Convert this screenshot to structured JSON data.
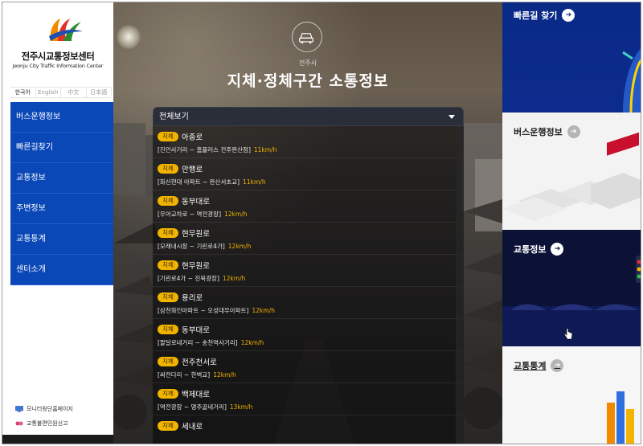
{
  "logo": {
    "title": "전주시교통정보센터",
    "subtitle": "Jeonju City Traffic Information Center"
  },
  "languages": [
    "한국어",
    "English",
    "中文",
    "日本語"
  ],
  "menu": [
    {
      "label": "버스운행정보"
    },
    {
      "label": "빠른길찾기"
    },
    {
      "label": "교통정보"
    },
    {
      "label": "주변정보"
    },
    {
      "label": "교통통계"
    },
    {
      "label": "센터소개"
    }
  ],
  "bottom_links": [
    {
      "label": "모니터링단홈페이지",
      "icon": "monitor-icon"
    },
    {
      "label": "교통불편민원신고",
      "icon": "complaint-icon"
    }
  ],
  "center": {
    "sub_title": "전주시",
    "title": "지체·정체구간 소통정보",
    "select_value": "전체보기",
    "rows": [
      {
        "badge": "지체",
        "road": "아중로",
        "section": "[진안사거리 ~ 홈플러스 전주완산점]",
        "speed": "11km/h"
      },
      {
        "badge": "지체",
        "road": "안행로",
        "section": "[화산현대 아파트 ~ 완산서초교]",
        "speed": "11km/h"
      },
      {
        "badge": "지체",
        "road": "동부대로",
        "section": "[우아교차로 ~ 역전광장]",
        "speed": "12km/h"
      },
      {
        "badge": "지체",
        "road": "현무원로",
        "section": "[모래내시장 ~ 기린로4가]",
        "speed": "12km/h"
      },
      {
        "badge": "지체",
        "road": "현무원로",
        "section": "[기린로4가 ~ 진북광장]",
        "speed": "12km/h"
      },
      {
        "badge": "지체",
        "road": "용리로",
        "section": "[삼천화인아파트 ~ 오성대우아파트]",
        "speed": "12km/h"
      },
      {
        "badge": "지체",
        "road": "동부대로",
        "section": "[팔달로네거리 ~ 송천역사거리]",
        "speed": "12km/h"
      },
      {
        "badge": "지체",
        "road": "전주천서로",
        "section": "[싸전다리 ~ 한벽교]",
        "speed": "12km/h"
      },
      {
        "badge": "지체",
        "road": "백제대로",
        "section": "[역전광장 ~ 명주골네거리]",
        "speed": "13km/h"
      },
      {
        "badge": "지체",
        "road": "세내로",
        "section": "",
        "speed": ""
      }
    ]
  },
  "right": {
    "cards": [
      {
        "title": "빠른길 찾기"
      },
      {
        "title": "버스운행정보"
      },
      {
        "title": "교통정보"
      },
      {
        "title": "교통통계"
      }
    ]
  },
  "colors": {
    "menu_bg": "#0a48b8",
    "badge": "#f2b400",
    "right_dark": "#0c2b8c"
  }
}
